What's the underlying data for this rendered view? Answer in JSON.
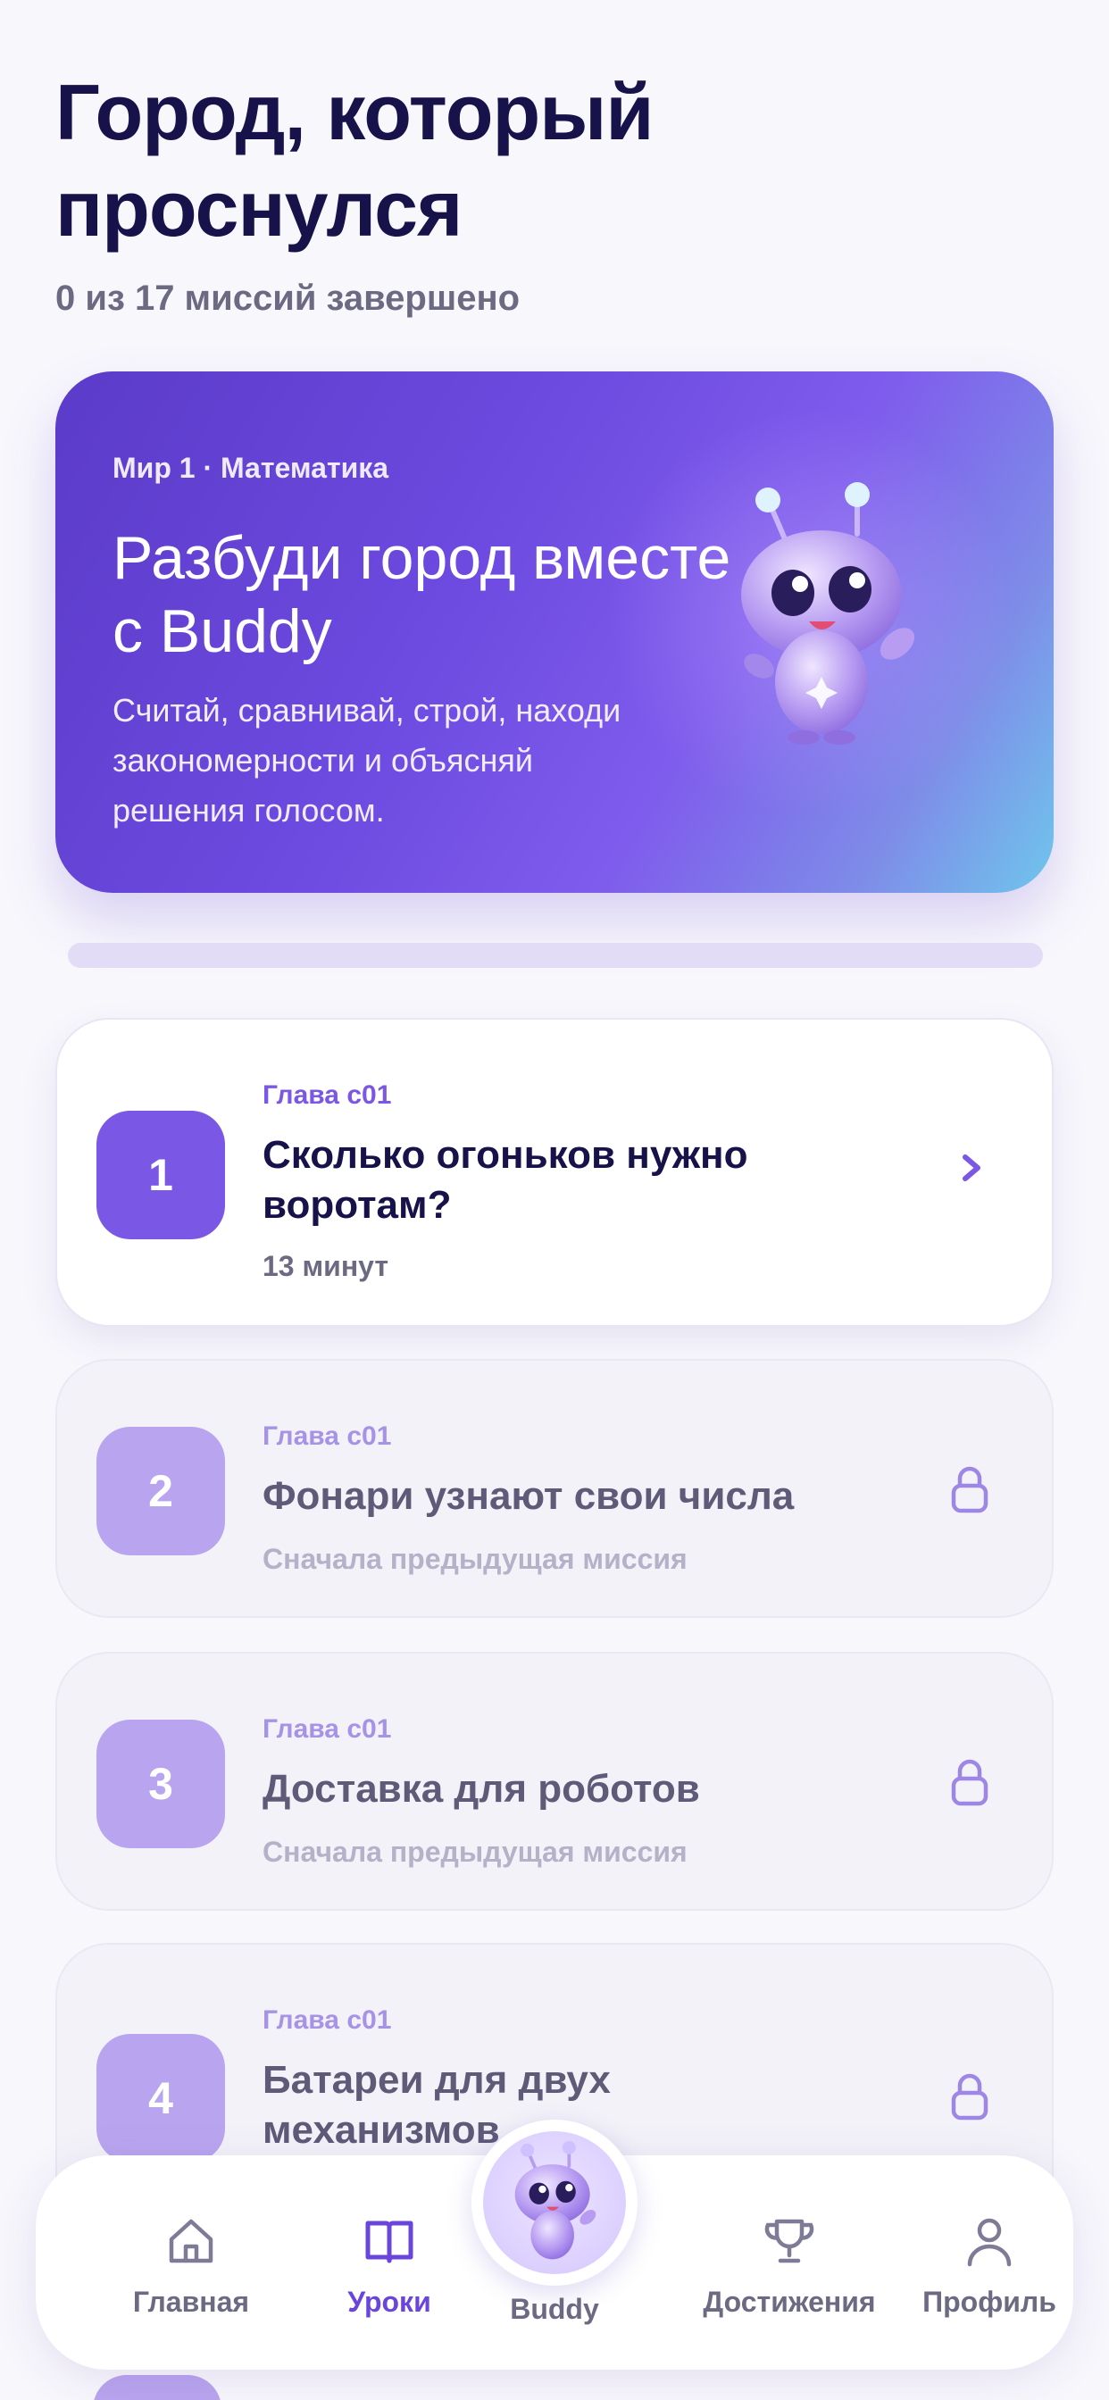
{
  "header": {
    "title": "Город, который проснулся",
    "subtitle": "0 из 17 миссий завершено"
  },
  "hero": {
    "tag": "Мир 1 · Математика",
    "title": "Разбуди город вместе с Buddy",
    "text": "Считай, сравнивай, строй, находи закономерности и объясняй решения голосом."
  },
  "progress": {
    "completed": 0,
    "total": 17
  },
  "missions": [
    {
      "number": "1",
      "chapter": "Глава с01",
      "title": "Сколько огоньков нужно воротам?",
      "meta": "13 минут",
      "state": "active",
      "icon": "chevron-right-icon"
    },
    {
      "number": "2",
      "chapter": "Глава с01",
      "title": "Фонари узнают свои числа",
      "meta": "Сначала предыдущая миссия",
      "state": "locked",
      "icon": "lock-icon"
    },
    {
      "number": "3",
      "chapter": "Глава с01",
      "title": "Доставка для роботов",
      "meta": "Сначала предыдущая миссия",
      "state": "locked",
      "icon": "lock-icon"
    },
    {
      "number": "4",
      "chapter": "Глава с01",
      "title": "Батареи для двух механизмов",
      "meta": "",
      "state": "locked",
      "icon": "lock-icon"
    }
  ],
  "tabbar": {
    "items": [
      {
        "label": "Главная",
        "icon": "home-icon",
        "active": false
      },
      {
        "label": "Уроки",
        "icon": "book-icon",
        "active": true
      },
      {
        "label": "Buddy",
        "icon": "buddy-mascot-icon",
        "active": false
      },
      {
        "label": "Достижения",
        "icon": "trophy-icon",
        "active": false
      },
      {
        "label": "Профиль",
        "icon": "profile-icon",
        "active": false
      }
    ]
  },
  "colors": {
    "accent": "#7b57e6",
    "title": "#17124a",
    "muted": "#6b6a82",
    "locked_badge": "#b9a5ef"
  }
}
